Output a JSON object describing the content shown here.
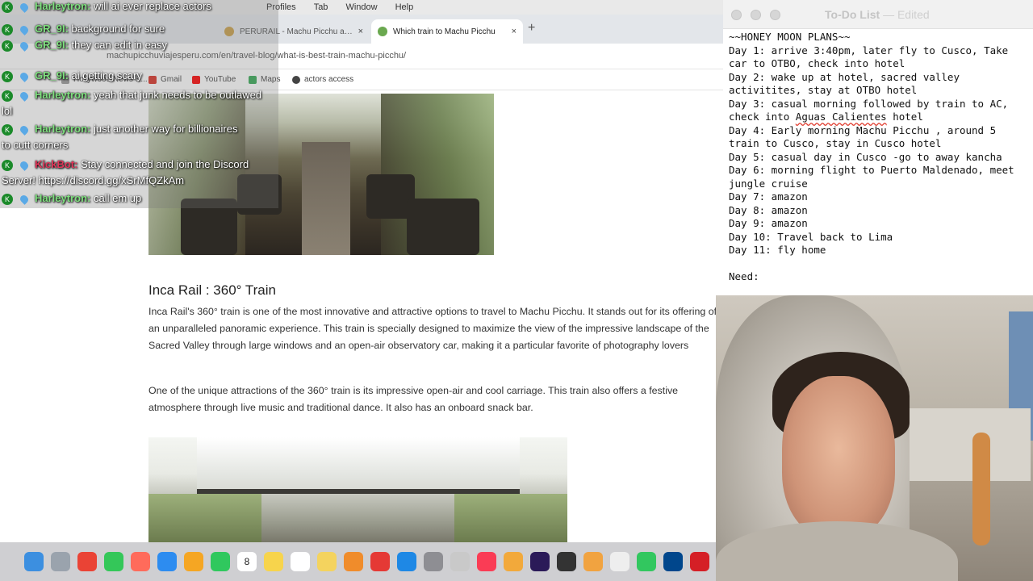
{
  "menubar": {
    "items": [
      "Profiles",
      "Tab",
      "Window",
      "Help"
    ]
  },
  "browser": {
    "tabs": [
      {
        "label": "PERURAIL - Machu Picchu and",
        "close": "×"
      },
      {
        "label": "Which train to Machu Picchu",
        "close": "×"
      }
    ],
    "new_tab": "+",
    "url": "machupicchuviajesperu.com/en/travel-blog/what-is-best-train-machu-picchu/",
    "bookmarks": [
      "Hollywood News &...",
      "Gmail",
      "YouTube",
      "Maps",
      "actors access"
    ]
  },
  "article": {
    "heading": "Inca Rail : 360° Train",
    "paragraph_1": "Inca Rail's 360° train is one of the most innovative and attractive options to travel to Machu Picchu. It stands out for its offering of an unparalleled panoramic experience. This train is specially designed to maximize the view of the impressive landscape of the Sacred Valley through large windows and an open-air observatory car, making it a particular favorite of photography lovers",
    "paragraph_2": "One of the unique attractions of the 360° train is its impressive open-air and cool carriage. This train also offers a festive atmosphere through live music and traditional dance. It also has an onboard snack bar."
  },
  "chat": [
    {
      "user": "Harleytron:",
      "text": "will ai ever replace actors",
      "user_color": "#7fe07f"
    },
    {
      "user": "GR_9I:",
      "text": "background for sure",
      "user_color": "#7fe07f"
    },
    {
      "user": "GR_9I:",
      "text": "they can edit in easy",
      "user_color": "#7fe07f"
    },
    {
      "user": "GR_9I:",
      "text": "ai getting scary",
      "user_color": "#7fe07f"
    },
    {
      "user": "Harleytron:",
      "text": "yeah that junk needs to be outlawed lol",
      "user_color": "#7fe07f"
    },
    {
      "user": "Harleytron:",
      "text": "just another way for billionaires to cutt corners",
      "user_color": "#7fe07f"
    },
    {
      "user": "KickBot:",
      "text": "Stay connected and join the Discord Server! https://discord.gg/xSrMfQZkAm",
      "user_color": "#e0375a"
    },
    {
      "user": "Harleytron:",
      "text": "call em up",
      "user_color": "#7fe07f"
    }
  ],
  "notes": {
    "title": "To-Do List",
    "status": "— Edited",
    "lines": [
      "~~HONEY MOON PLANS~~",
      "Day 1: arrive 3:40pm, later fly to Cusco, Take car to OTBO, check into hotel",
      "Day 2: wake up at hotel, sacred valley activitites, stay at OTBO hotel",
      "Day 3: casual morning followed by train to AC, check into Aguas Calientes hotel",
      "Day 4: Early morning Machu Picchu , around 5 train to Cusco, stay in Cusco hotel",
      "Day 5: casual day in Cusco -go to away kancha",
      "Day 6: morning flight to Puerto Maldenado, meet jungle cruise",
      "Day 7: amazon",
      "Day 8: amazon",
      "Day 9: amazon",
      "Day 10: Travel back to Lima",
      "Day 11: fly home",
      "",
      "Need:"
    ]
  },
  "dock": {
    "apps": [
      "finder",
      "launchpad",
      "chrome",
      "messages",
      "mail",
      "appstore",
      "photos",
      "facetime",
      "calendar",
      "notes",
      "reminders",
      "stickies",
      "pages",
      "news",
      "appstore2",
      "settings",
      "preview",
      "music",
      "fruit",
      "premiere",
      "piano",
      "pencil",
      "textedit",
      "numbers",
      "photoshop",
      "acrobat"
    ],
    "calendar_day": "8"
  },
  "colors": {
    "chat_green": "#7fe07f",
    "chat_red": "#e0375a",
    "spell_red": "#e0392b"
  }
}
